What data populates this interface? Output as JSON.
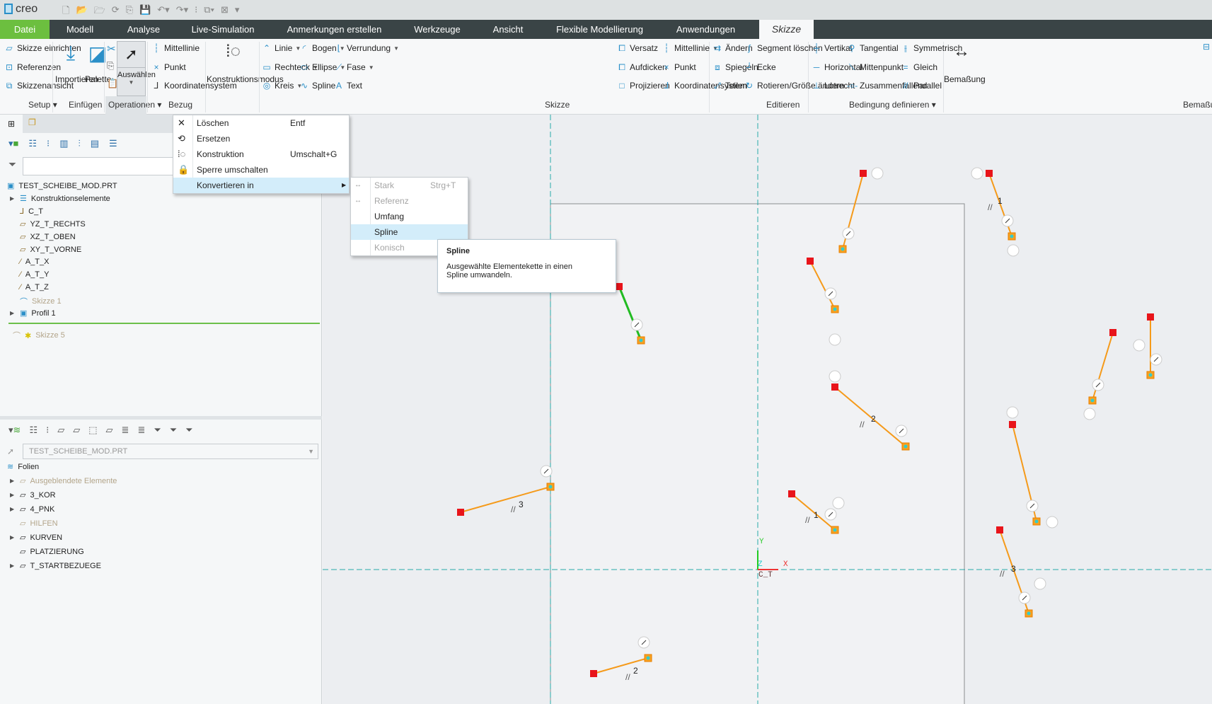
{
  "app": {
    "logo": "creo",
    "quick_access_icons": [
      "new-icon",
      "open-icon",
      "open-session-icon",
      "regenerate-icon",
      "copy-icon",
      "save-icon",
      "undo-icon",
      "redo-icon",
      "regen-manager-icon",
      "windows-icon",
      "close-window-icon",
      "customize-icon"
    ]
  },
  "tabs": [
    "Datei",
    "Modell",
    "Analyse",
    "Live-Simulation",
    "Anmerkungen erstellen",
    "Werkzeuge",
    "Ansicht",
    "Flexible Modellierung",
    "Anwendungen",
    "Skizze"
  ],
  "active_tab": "Skizze",
  "ribbon": {
    "setup": {
      "items": [
        "Skizze einrichten",
        "Referenzen",
        "Skizzenansicht"
      ],
      "label": "Setup"
    },
    "einfuegen": {
      "items": [
        "Importieren",
        "Palette"
      ],
      "label": "Einfügen"
    },
    "operationen": {
      "select": "Auswählen",
      "label": "Operationen"
    },
    "bezug": {
      "items": [
        "Mittellinie",
        "Punkt",
        "Koordinatensystem"
      ],
      "label": "Bezug"
    },
    "konstruktionsmodus": "Konstruktionsmodus",
    "skizze": {
      "items": [
        "Linie",
        "Rechteck",
        "Kreis",
        "Bogen",
        "Ellipse",
        "Spline",
        "Verrundung",
        "Fase",
        "Text",
        "Versatz",
        "Aufdicken",
        "Projizieren",
        "Mittellinie",
        "Punkt",
        "Koordinatensystem"
      ],
      "label": "Skizze"
    },
    "editieren": {
      "items": [
        "Ändern",
        "Spiegeln",
        "Teilen",
        "Segment löschen",
        "Ecke",
        "Rotieren/Größe ändern"
      ],
      "label": "Editieren"
    },
    "bedingung": {
      "items": [
        "Vertikal",
        "Horizontal",
        "Lotrecht",
        "Tangential",
        "Mittenpunkt",
        "Zusammenfallend",
        "Symmetrisch",
        "Gleich",
        "Parallel"
      ],
      "label": "Bedingung definieren"
    },
    "bemassung": {
      "button": "Bemaßung",
      "label": "Bemaßung"
    }
  },
  "model_tree": {
    "search_placeholder": "",
    "root": "TEST_SCHEIBE_MOD.PRT",
    "items": [
      "Konstruktionselemente",
      "C_T",
      "YZ_T_RECHTS",
      "XZ_T_OBEN",
      "XY_T_VORNE",
      "A_T_X",
      "A_T_Y",
      "A_T_Z",
      "Skizze 1",
      "Profil 1"
    ],
    "inserted": "Skizze 5"
  },
  "layers": {
    "combo_value": "TEST_SCHEIBE_MOD.PRT",
    "root": "Folien",
    "items": [
      "Ausgeblendete Elemente",
      "3_KOR",
      "4_PNK",
      "HILFEN",
      "KURVEN",
      "PLATZIERUNG",
      "T_STARTBEZUEGE"
    ]
  },
  "context_menu": {
    "items": [
      {
        "label": "Löschen",
        "shortcut": "Entf"
      },
      {
        "label": "Ersetzen",
        "shortcut": ""
      },
      {
        "label": "Konstruktion",
        "shortcut": "Umschalt+G"
      },
      {
        "label": "Sperre umschalten",
        "shortcut": ""
      },
      {
        "label": "Konvertieren in",
        "shortcut": ""
      }
    ]
  },
  "submenu": {
    "items": [
      {
        "label": "Stark",
        "shortcut": "Strg+T"
      },
      {
        "label": "Referenz",
        "shortcut": ""
      },
      {
        "label": "Umfang",
        "shortcut": ""
      },
      {
        "label": "Spline",
        "shortcut": ""
      },
      {
        "label": "Konisch",
        "shortcut": ""
      }
    ]
  },
  "tooltip": {
    "title": "Spline",
    "text1": "Ausgewählte Elementekette in einen",
    "text2": "Spline umwandeln."
  },
  "canvas": {
    "csys": "C_T",
    "axis_x": "X",
    "axis_y": "Y",
    "axis_z": "Z",
    "dims": [
      "2",
      "1",
      "1",
      "3",
      "3",
      "2"
    ]
  },
  "colors": {
    "accent": "#6cbf3f",
    "line": "#f59a1a",
    "selected": "#22bb22",
    "start": "#e8141a",
    "centerline": "#27a9a9"
  }
}
